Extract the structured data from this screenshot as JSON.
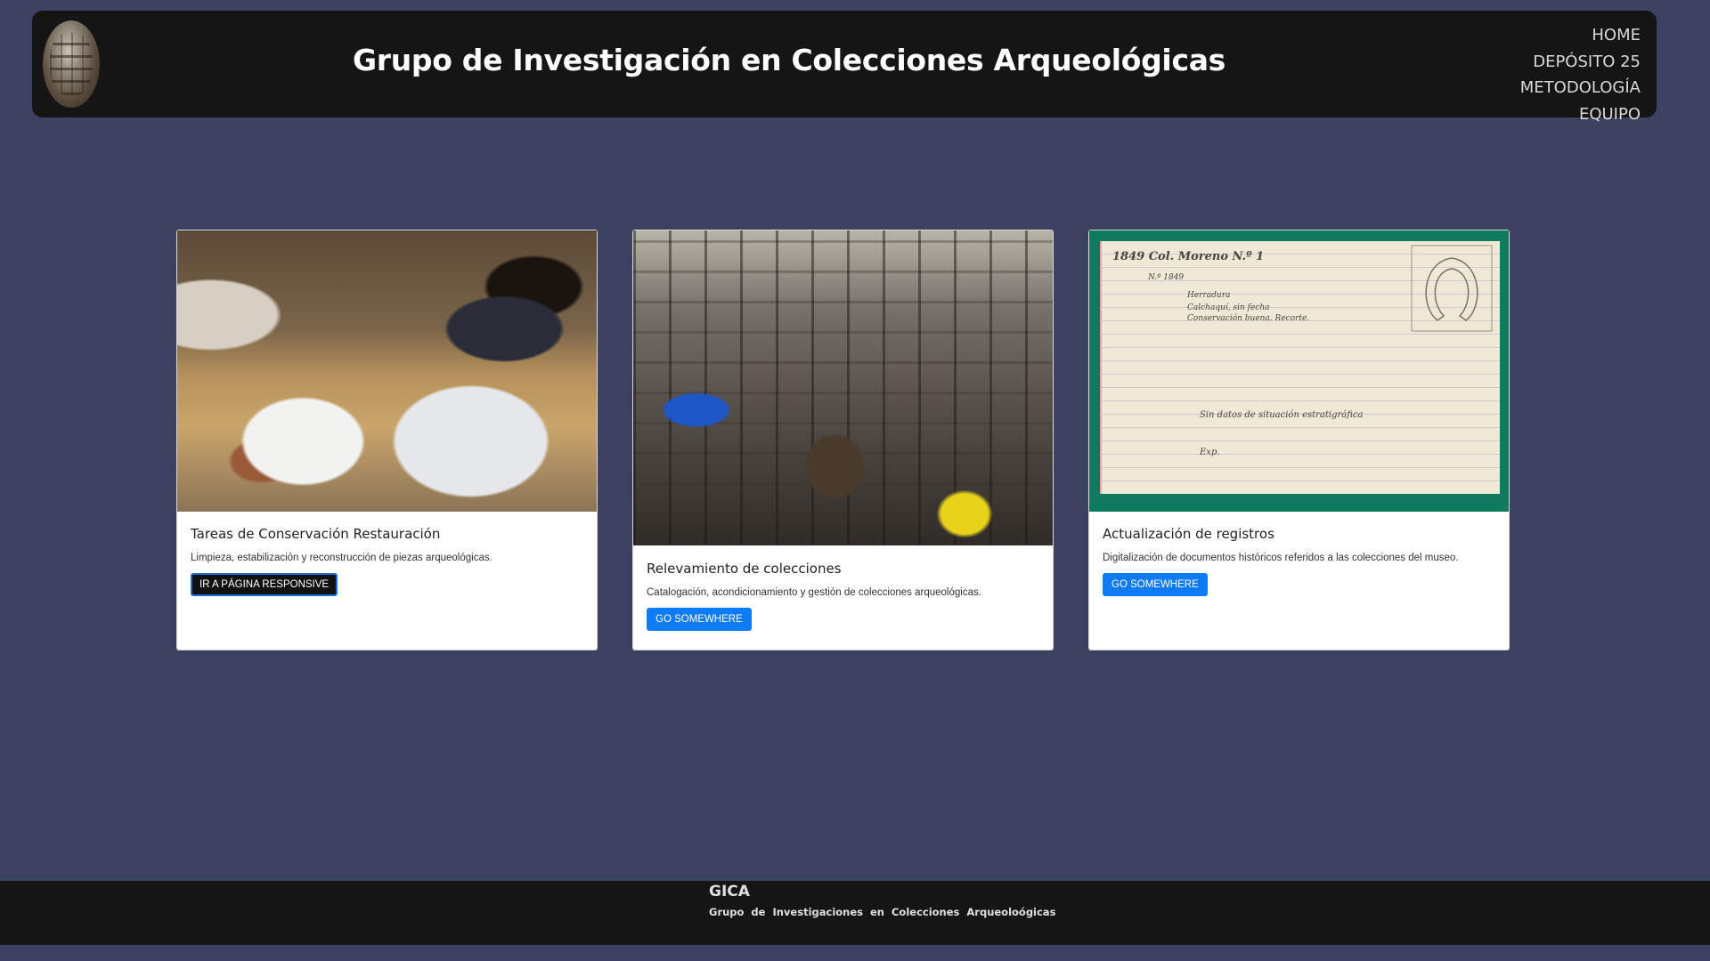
{
  "header": {
    "title": "Grupo de Investigación en Colecciones Arqueológicas",
    "nav": [
      "HOME",
      "DEPÓSITO 25",
      "METODOLOGÍA",
      "EQUIPO"
    ]
  },
  "cards": [
    {
      "title": "Tareas de Conservación Restauración",
      "text": "Limpieza, estabilización y reconstrucción de piezas arqueológicas.",
      "button": "IR A PÁGINA RESPONSIVE"
    },
    {
      "title": "Relevamiento de colecciones",
      "text": "Catalogación, acondicionamiento y gestión de colecciones arqueológicas.",
      "button": "GO SOMEWHERE"
    },
    {
      "title": "Actualización de registros",
      "text": "Digitalización de documentos históricos referidos a las colecciones del museo.",
      "button": "GO SOMEWHERE"
    }
  ],
  "document_image": {
    "line1": "1849 Col. Moreno N.º 1",
    "line2": "N.º 1849",
    "line3": "Herradura",
    "line4": "Calchaquí, sin fecha",
    "line5": "Conservación buena. Recorte.",
    "line6": "Sin datos de situación estratigráfica",
    "line7": "Exp."
  },
  "footer": {
    "brand": "GICA",
    "subtitle": "Grupo de Investigaciones en Colecciones Arqueoloógicas"
  },
  "colors": {
    "page_background": "#3c4160",
    "header_background": "#151515",
    "button_primary": "#0d7bf5",
    "button_dark": "#111111"
  }
}
